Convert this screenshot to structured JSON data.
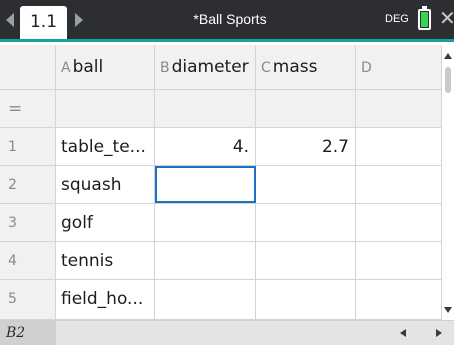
{
  "titlebar": {
    "tab_label": "1.1",
    "document_title": "*Ball Sports",
    "angle_mode": "DEG",
    "battery_color": "#39d353",
    "accent_color": "#14a3a0"
  },
  "columns": [
    {
      "letter": "A",
      "name": "ball"
    },
    {
      "letter": "B",
      "name": "diameter"
    },
    {
      "letter": "C",
      "name": "mass"
    },
    {
      "letter": "D",
      "name": ""
    }
  ],
  "formula_row": {
    "label": "="
  },
  "rows": [
    {
      "num": "1",
      "a": "table_te...",
      "b": "4.",
      "c": "2.7",
      "d": ""
    },
    {
      "num": "2",
      "a": "squash",
      "b": "",
      "c": "",
      "d": ""
    },
    {
      "num": "3",
      "a": "golf",
      "b": "",
      "c": "",
      "d": ""
    },
    {
      "num": "4",
      "a": "tennis",
      "b": "",
      "c": "",
      "d": ""
    },
    {
      "num": "5",
      "a": "field_ho...",
      "b": "",
      "c": "",
      "d": ""
    }
  ],
  "status": {
    "cell_reference": "B2"
  },
  "selection_color": "#1a6fc9"
}
